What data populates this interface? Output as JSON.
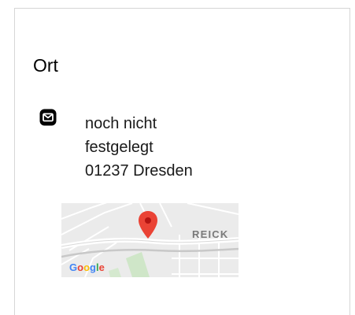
{
  "location": {
    "title": "Ort",
    "address_lines": [
      "noch nicht",
      "festgelegt",
      "01237 Dresden"
    ],
    "icon": "mail-icon"
  },
  "map": {
    "area_label": "REICK",
    "provider_logo": "Google",
    "pin_color": "#ea4335",
    "icon": "map-pin-icon"
  }
}
